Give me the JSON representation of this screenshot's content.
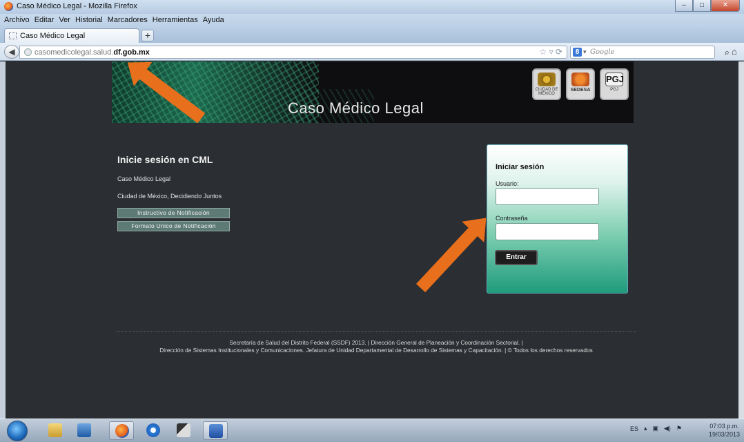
{
  "window": {
    "title": "Caso Médico Legal - Mozilla Firefox"
  },
  "menu": [
    "Archivo",
    "Editar",
    "Ver",
    "Historial",
    "Marcadores",
    "Herramientas",
    "Ayuda"
  ],
  "tab": {
    "label": "Caso Médico Legal",
    "new_tab": "+"
  },
  "nav": {
    "url_prefix": "casomedicolegal.salud.",
    "url_domain": "df.gob.mx",
    "search_placeholder": "Google"
  },
  "banner": {
    "title": "Caso Médico Legal",
    "logos": [
      "CIUDAD DE MÉXICO",
      "SEDESA",
      "PGJ"
    ]
  },
  "intro": {
    "heading": "Inicie sesión en CML",
    "line1": "Caso Médico Legal",
    "line2": "Ciudad de México, Decidiendo Juntos",
    "buttons": [
      "Instructivo de Notificación",
      "Formato Unico de Notificación"
    ]
  },
  "login": {
    "title": "Iniciar sesión",
    "user_label": "Usuario:",
    "user_value": "",
    "password_label": "Contraseña",
    "password_value": "",
    "submit": "Entrar"
  },
  "footer": {
    "line1": "Secretaría de Salud del Distrito Federal (SSDF) 2013.  |  Dirección General de Planeación y Coordinación Sectorial.  |",
    "line2": "Dirección de Sistemas Institucionales y Comunicaciones. Jefatura de Unidad Departamental de Desarrollo de Sistemas y Capacitación.  |  © Todos los derechos reservados"
  },
  "taskbar": {
    "language": "ES",
    "time": "07:03 p.m.",
    "date": "19/03/2013"
  },
  "colors": {
    "page_bg": "#2b2e33",
    "arrow": "#e86f1c",
    "login_gradient_end": "#1f9b7c"
  }
}
